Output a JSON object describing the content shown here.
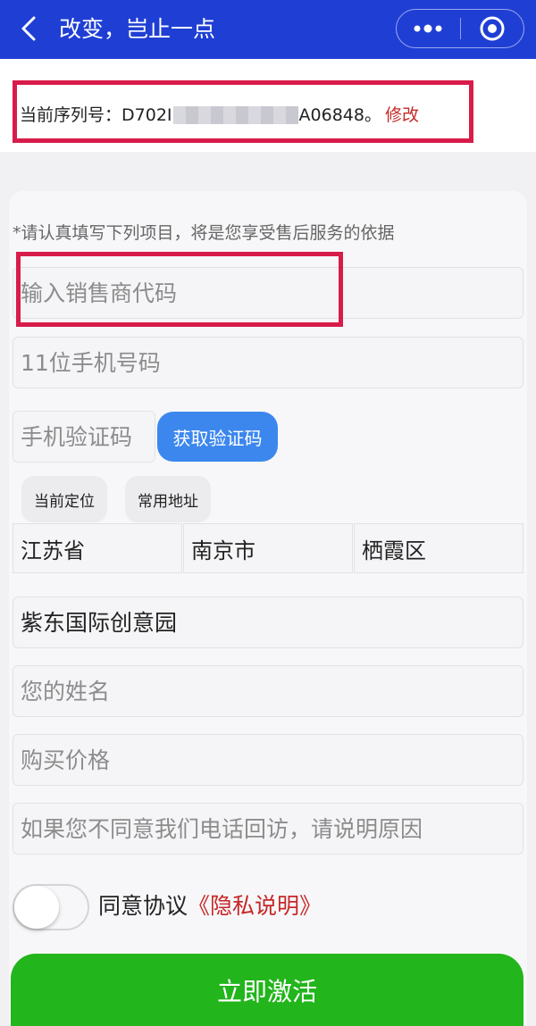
{
  "header": {
    "title": "改变，岂止一点",
    "back_icon": "chevron-left-icon",
    "more_icon": "more-dots-icon",
    "close_icon": "target-circle-icon"
  },
  "serial": {
    "label": "当前序列号：",
    "prefix": "D702I",
    "suffix": "A06848。",
    "edit_label": "修改"
  },
  "form": {
    "hint": "*请认真填写下列项目，将是您享受售后服务的依据",
    "dealer_code_placeholder": "输入销售商代码",
    "phone_placeholder": "11位手机号码",
    "sms_code_placeholder": "手机验证码",
    "get_code_label": "获取验证码",
    "current_location_label": "当前定位",
    "common_address_label": "常用地址",
    "province": "江苏省",
    "city": "南京市",
    "district": "栖霞区",
    "address_value": "紫东国际创意园",
    "name_placeholder": "您的姓名",
    "price_placeholder": "购买价格",
    "reason_placeholder": "如果您不同意我们电话回访，请说明原因",
    "agree_prefix": "同意协议",
    "agree_link": "《隐私说明》",
    "activate_label": "立即激活"
  },
  "colors": {
    "header_bg": "#1f3fd4",
    "highlight_red": "#d81c4a",
    "link_red": "#c62828",
    "primary_blue": "#3c87ee",
    "activate_green": "#22b51c"
  }
}
